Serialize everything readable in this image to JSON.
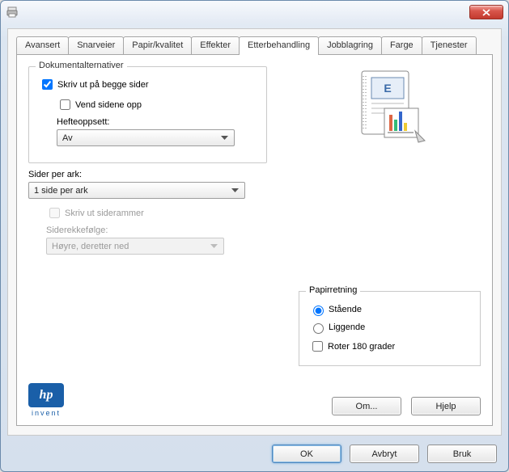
{
  "tabs": {
    "t0": "Avansert",
    "t1": "Snarveier",
    "t2": "Papir/kvalitet",
    "t3": "Effekter",
    "t4": "Etterbehandling",
    "t5": "Jobblagring",
    "t6": "Farge",
    "t7": "Tjenester"
  },
  "docopts": {
    "legend": "Dokumentalternativer",
    "duplex": "Skriv ut på begge sider",
    "flip": "Vend sidene opp",
    "booklet_label": "Hefteoppsett:",
    "booklet_value": "Av",
    "pages_label": "Sider per ark:",
    "pages_value": "1 side per ark",
    "borders": "Skriv ut siderammer",
    "order_label": "Siderekkefølge:",
    "order_value": "Høyre, deretter ned"
  },
  "paper": {
    "legend": "Papirretning",
    "portrait": "Stående",
    "landscape": "Liggende",
    "rotate": "Roter 180 grader"
  },
  "logo": {
    "brand": "hp",
    "sub": "invent"
  },
  "buttons": {
    "about": "Om...",
    "help": "Hjelp",
    "ok": "OK",
    "cancel": "Avbryt",
    "apply": "Bruk"
  }
}
